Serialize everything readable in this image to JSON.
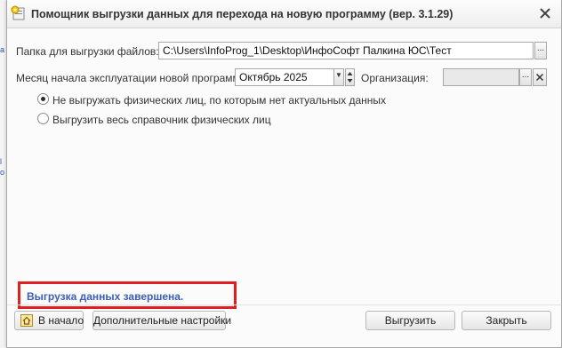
{
  "window": {
    "title": "Помощник выгрузки данных для перехода на новую программу (вер. 3.1.29)"
  },
  "form": {
    "folder_label": "Папка для выгрузки файлов:",
    "folder_value": "C:\\Users\\InfoProg_1\\Desktop\\ИнфоСофт Палкина ЮС\\Тест",
    "month_label": "Месяц начала эксплуатации новой программы:",
    "month_value": "Октябрь 2025",
    "org_label": "Организация:",
    "org_value": "",
    "browse_glyph": "...",
    "dropdown_glyph": "▼",
    "radio_options": [
      {
        "label": "Не выгружать физических лиц, по которым нет актуальных данных",
        "selected": true
      },
      {
        "label": "Выгрузить весь справочник физических лиц",
        "selected": false
      }
    ]
  },
  "status": {
    "text": "Выгрузка данных завершена."
  },
  "buttons": {
    "home_label": "В начало",
    "settings_label": "Дополнительные настройки",
    "export_label": "Выгрузить",
    "close_label": "Закрыть"
  },
  "background": {
    "left_marks": [
      "a",
      "l",
      "o"
    ]
  },
  "colors": {
    "highlight_border": "#e02020",
    "status_text": "#3a5fb5"
  }
}
